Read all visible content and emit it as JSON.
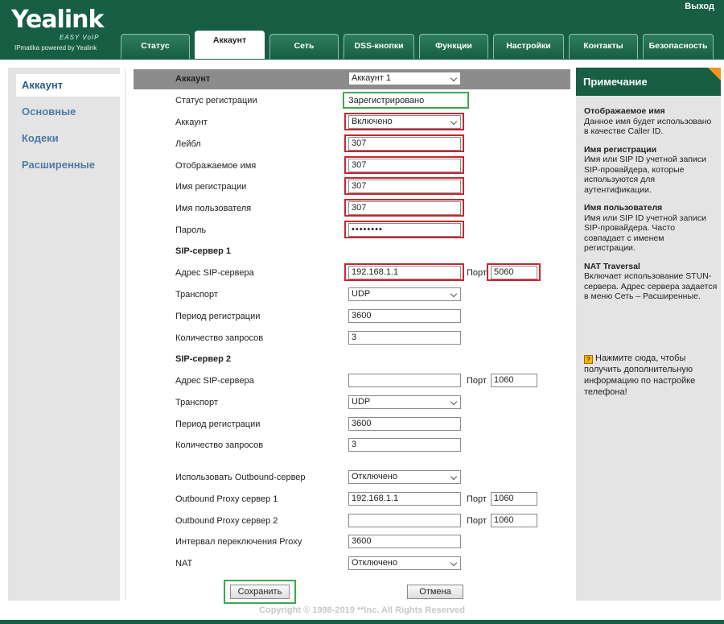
{
  "header": {
    "brand": "Yealink",
    "brand_sub": "EASY VoIP",
    "tagline": "IPmatika powered by Yealink",
    "exit": "Выход"
  },
  "tabs": [
    {
      "label": "Статус"
    },
    {
      "label": "Аккаунт"
    },
    {
      "label": "Сеть"
    },
    {
      "label": "DSS-кнопки"
    },
    {
      "label": "Функции"
    },
    {
      "label": "Настройки"
    },
    {
      "label": "Контакты"
    },
    {
      "label": "Безопасность"
    }
  ],
  "sidebar": {
    "items": [
      {
        "label": "Аккаунт"
      },
      {
        "label": "Основные"
      },
      {
        "label": "Кодеки"
      },
      {
        "label": "Расширенные"
      }
    ]
  },
  "form": {
    "account_label": "Аккаунт",
    "account_value": "Аккаунт 1",
    "reg_status_label": "Статус регистрации",
    "reg_status_value": "Зарегистрировано",
    "enable_label": "Аккаунт",
    "enable_value": "Включено",
    "label_label": "Лейбл",
    "label_value": "307",
    "display_name_label": "Отображаемое имя",
    "display_name_value": "307",
    "register_name_label": "Имя регистрации",
    "register_name_value": "307",
    "username_label": "Имя пользователя",
    "username_value": "307",
    "password_label": "Пароль",
    "password_value": "••••••••",
    "sip1_heading": "SIP-сервер 1",
    "sip1_addr_label": "Адрес SIP-сервера",
    "sip1_addr_value": "192.168.1.1",
    "port_label": "Порт",
    "sip1_port_value": "5060",
    "sip1_transport_label": "Транспорт",
    "sip1_transport_value": "UDP",
    "sip1_period_label": "Период регистрации",
    "sip1_period_value": "3600",
    "sip1_retry_label": "Количество запросов",
    "sip1_retry_value": "3",
    "sip2_heading": "SIP-сервер 2",
    "sip2_addr_label": "Адрес SIP-сервера",
    "sip2_addr_value": "",
    "sip2_port_value": "1060",
    "sip2_transport_label": "Транспорт",
    "sip2_transport_value": "UDP",
    "sip2_period_label": "Период регистрации",
    "sip2_period_value": "3600",
    "sip2_retry_label": "Количество запросов",
    "sip2_retry_value": "3",
    "outbound_label": "Использовать Outbound-сервер",
    "outbound_value": "Отключено",
    "proxy1_label": "Outbound Proxy сервер 1",
    "proxy1_value": "192.168.1.1",
    "proxy1_port_value": "1060",
    "proxy2_label": "Outbound Proxy сервер 2",
    "proxy2_value": "",
    "proxy2_port_value": "1060",
    "failback_label": "Интервал переключения Proxy",
    "failback_value": "3600",
    "nat_label": "NAT",
    "nat_value": "Отключено",
    "save_label": "Сохранить",
    "cancel_label": "Отмена"
  },
  "note": {
    "heading": "Примечание",
    "items": [
      {
        "title": "Отображаемое имя",
        "text": "Данное имя будет использовано в качестве Caller ID."
      },
      {
        "title": "Имя регистрации",
        "text": "Имя или SIP ID учетной записи SIP-провайдера, которые используются для аутентификации."
      },
      {
        "title": "Имя пользователя",
        "text": "Имя или SIP ID учетной записи SIP-провайдера. Часто совпадает с именем регистрации."
      },
      {
        "title": "NAT Traversal",
        "text": "Включает использование STUN-сервера. Адрес сервера задается в меню Сеть – Расширенные."
      }
    ],
    "help_icon": "help-icon",
    "help_text": "Нажмите сюда, чтобы получить дополнительную информацию по настройке телефона!"
  },
  "footer": {
    "copyright": "Copyright © 1998-2019 **Inc. All Rights Reserved"
  },
  "colors": {
    "brand_green": "#175e45",
    "highlight_red": "#c8262f",
    "highlight_green": "#3ea84f",
    "note_corner": "#f7941d"
  }
}
